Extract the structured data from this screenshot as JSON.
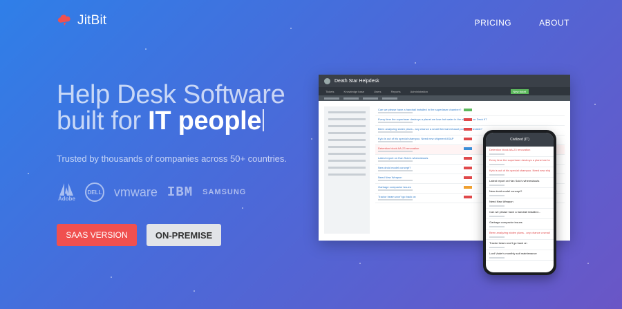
{
  "brand": {
    "name": "JitBit",
    "color": "#f0504f"
  },
  "nav": {
    "pricing": "PRICING",
    "about": "ABOUT"
  },
  "hero": {
    "line1": "Help Desk Software",
    "line2_prefix": "built for ",
    "line2_highlight": "IT people",
    "subtitle": "Trusted by thousands of companies across 50+ countries."
  },
  "clients": {
    "adobe": "Adobe",
    "dell": "DELL",
    "vmware": "vmware",
    "ibm": "IBM",
    "samsung": "SAMSUNG"
  },
  "buttons": {
    "saas": "SAAS VERSION",
    "onprem": "ON-PREMISE"
  },
  "desktop_app": {
    "title": "Death Star Helpdesk",
    "tabs": [
      "Tickets",
      "Knowledge base",
      "Users",
      "Reports",
      "Administration"
    ],
    "new_ticket": "New ticket",
    "tickets": [
      {
        "title": "Can we please have a handrail installed in the superlaser chamber?",
        "status": "green"
      },
      {
        "title": "Every time the superlaser destroys a planet we lose hot water in the showers on Deck 97",
        "status": "red"
      },
      {
        "title": "Been analyzing stolen plans - any chance a small thermal exhaust port is vulnerable?",
        "status": "red"
      },
      {
        "title": "Kylo is out of his special shampoo. Need new shipment ASAP",
        "status": "red"
      },
      {
        "title": "Detention block AA-23 renovation",
        "status": "blue",
        "highlight": true
      },
      {
        "title": "Latest report on Han Solo's whereabouts",
        "status": "red"
      },
      {
        "title": "New droid model concept?",
        "status": "red"
      },
      {
        "title": "Need New Weapon",
        "status": "red"
      },
      {
        "title": "Garbage compactor issues",
        "status": "orange"
      },
      {
        "title": "Tractor beam won't go back on",
        "status": "red"
      }
    ]
  },
  "mobile_app": {
    "title": "Civilized (IT)",
    "tickets": [
      {
        "title": "Detention block AA-23 renovation",
        "red": true
      },
      {
        "title": "Every time the superlaser destroys a planet we lose hot water",
        "red": true
      },
      {
        "title": "Kylo is out of his special shampoo. Need new shipment",
        "red": true
      },
      {
        "title": "Latest report on Han Solo's whereabouts",
        "red": false
      },
      {
        "title": "New droid model concept?",
        "red": false
      },
      {
        "title": "Need New Weapon",
        "red": false
      },
      {
        "title": "Can we please have a handrail installed...",
        "red": false
      },
      {
        "title": "Garbage compactor issues",
        "red": false
      },
      {
        "title": "Been analyzing stolen plans - any chance a small...",
        "red": true
      },
      {
        "title": "Tractor beam won't go back on",
        "red": false
      },
      {
        "title": "Lord Vader's monthly suit maintenance",
        "red": false
      }
    ]
  },
  "colors": {
    "saas_button": "#f0504f",
    "onprem_button": "#e2e4e8",
    "bg_start": "#2f7fe8",
    "bg_end": "#6a56c6"
  }
}
